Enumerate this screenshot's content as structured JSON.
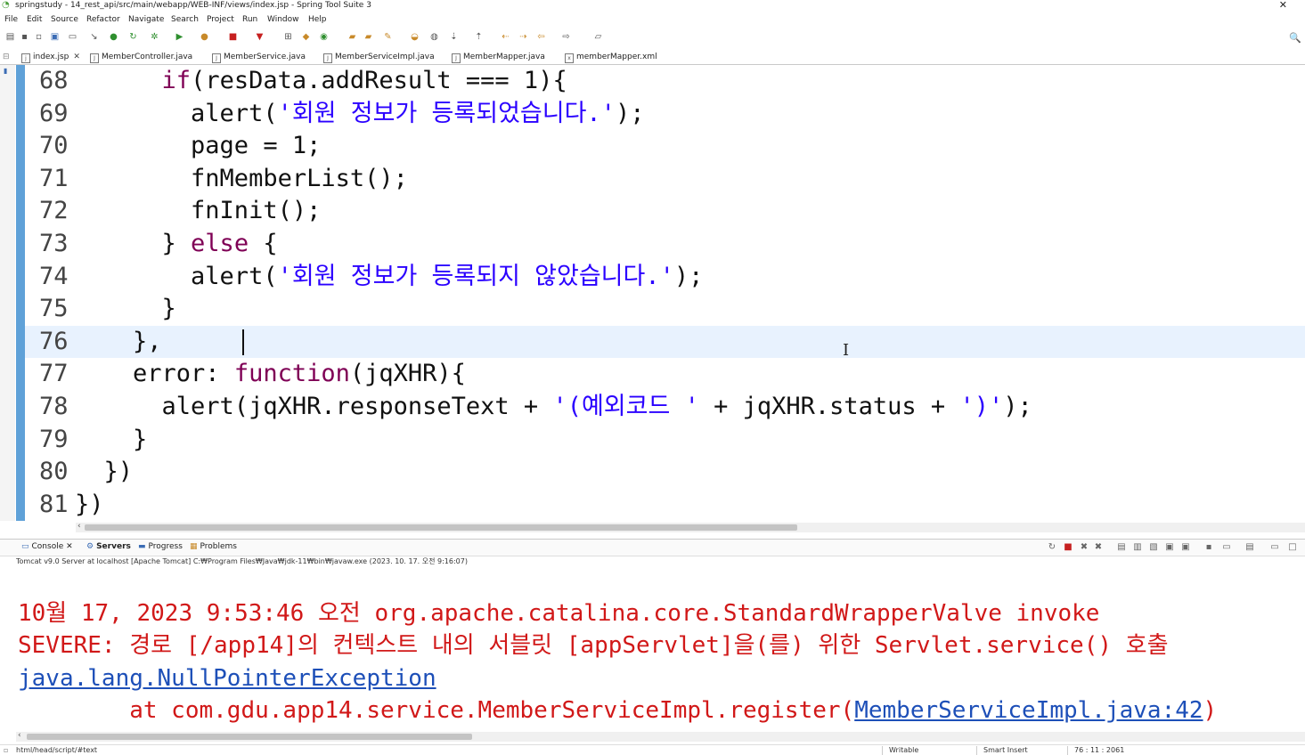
{
  "window": {
    "title": "springstudy - 14_rest_api/src/main/webapp/WEB-INF/views/index.jsp - Spring Tool Suite 3",
    "close_glyph": "✕"
  },
  "menu": [
    "File",
    "Edit",
    "Source",
    "Refactor",
    "Navigate",
    "Search",
    "Project",
    "Run",
    "Window",
    "Help"
  ],
  "editor_tabs": [
    {
      "label": "index.jsp",
      "icon": "jsp-file-icon",
      "active": true,
      "close": "✕"
    },
    {
      "label": "MemberController.java",
      "icon": "java-file-icon"
    },
    {
      "label": "MemberService.java",
      "icon": "java-file-icon"
    },
    {
      "label": "MemberServiceImpl.java",
      "icon": "java-file-icon"
    },
    {
      "label": "MemberMapper.java",
      "icon": "java-file-icon"
    },
    {
      "label": "memberMapper.xml",
      "icon": "xml-file-icon"
    }
  ],
  "code_lines": [
    {
      "n": "68",
      "parts": [
        {
          "t": "      "
        },
        {
          "t": "if",
          "c": "kw"
        },
        {
          "t": "(resData.addResult === 1){"
        }
      ]
    },
    {
      "n": "69",
      "parts": [
        {
          "t": "        alert("
        },
        {
          "t": "'회원 정보가 등록되었습니다.'",
          "c": "str"
        },
        {
          "t": ");"
        }
      ]
    },
    {
      "n": "70",
      "parts": [
        {
          "t": "        page = 1;"
        }
      ]
    },
    {
      "n": "71",
      "parts": [
        {
          "t": "        fnMemberList();"
        }
      ]
    },
    {
      "n": "72",
      "parts": [
        {
          "t": "        fnInit();"
        }
      ]
    },
    {
      "n": "73",
      "parts": [
        {
          "t": "      } "
        },
        {
          "t": "else",
          "c": "kw"
        },
        {
          "t": " {"
        }
      ]
    },
    {
      "n": "74",
      "parts": [
        {
          "t": "        alert("
        },
        {
          "t": "'회원 정보가 등록되지 않았습니다.'",
          "c": "str"
        },
        {
          "t": ");"
        }
      ]
    },
    {
      "n": "75",
      "parts": [
        {
          "t": "      }"
        }
      ]
    },
    {
      "n": "76",
      "parts": [
        {
          "t": "    },"
        }
      ],
      "current": true
    },
    {
      "n": "77",
      "parts": [
        {
          "t": "    error: "
        },
        {
          "t": "function",
          "c": "kw"
        },
        {
          "t": "(jqXHR){"
        }
      ]
    },
    {
      "n": "78",
      "parts": [
        {
          "t": "      alert(jqXHR.responseText + "
        },
        {
          "t": "'(예외코드 '",
          "c": "str"
        },
        {
          "t": " + jqXHR.status + "
        },
        {
          "t": "')'",
          "c": "str"
        },
        {
          "t": ");"
        }
      ]
    },
    {
      "n": "79",
      "parts": [
        {
          "t": "    }"
        }
      ]
    },
    {
      "n": "80",
      "parts": [
        {
          "t": "  })"
        }
      ]
    },
    {
      "n": "81",
      "parts": [
        {
          "t": "})"
        }
      ]
    }
  ],
  "console_panel": {
    "tabs": [
      {
        "label": "Console",
        "icon": "console-icon",
        "close": "✕"
      },
      {
        "label": "Servers",
        "icon": "servers-icon",
        "bold": true
      },
      {
        "label": "Progress",
        "icon": "progress-icon"
      },
      {
        "label": "Problems",
        "icon": "problems-icon"
      }
    ],
    "server_line": "Tomcat v9.0 Server at localhost [Apache Tomcat] C:₩Program Files₩Java₩jdk-11₩bin₩javaw.exe  (2023. 10. 17. 오전 9:16:07)",
    "output": [
      {
        "text": "10월 17, 2023 9:53:46 오전 org.apache.catalina.core.StandardWrapperValve invoke"
      },
      {
        "text": "SEVERE: 경로 [/app14]의 컨텍스트 내의 서블릿 [appServlet]을(를) 위한 Servlet.service() 호출"
      },
      {
        "link": "java.lang.NullPointerException"
      },
      {
        "text": "        at com.gdu.app14.service.MemberServiceImpl.register(",
        "link": "MemberServiceImpl.java:42",
        "tail": ")"
      }
    ]
  },
  "status_bar": {
    "path": "html/head/script/#text",
    "mode": "Writable",
    "insert": "Smart Insert",
    "position": "76 : 11 : 2061"
  }
}
